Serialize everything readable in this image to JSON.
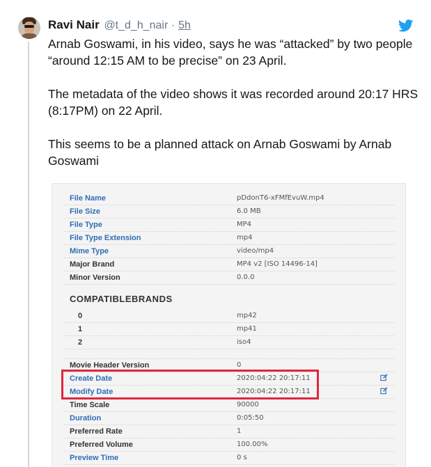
{
  "tweet": {
    "display_name": "Ravi Nair",
    "handle": "@t_d_h_nair",
    "separator": "·",
    "time": "5h",
    "paragraphs": [
      "Arnab Goswami, in his video, says he was “attacked” by two people “around 12:15 AM to be precise” on 23 April.",
      "The metadata of the video shows it was recorded around 20:17 HRS (8:17PM) on 22 April.",
      "This seems to be a planned attack on Arnab Goswami by Arnab Goswami"
    ]
  },
  "icons": {
    "brand": "twitter-bird-icon",
    "edit": "edit-icon",
    "brand_color": "#1da1f2",
    "highlight_color": "#e0263d"
  },
  "metadata": {
    "rows_top": [
      {
        "key": "File Name",
        "value": "pDdonT6-xFMfEvuW.mp4",
        "link": true
      },
      {
        "key": "File Size",
        "value": "6.0 MB",
        "link": true
      },
      {
        "key": "File Type",
        "value": "MP4",
        "link": true
      },
      {
        "key": "File Type Extension",
        "value": "mp4",
        "link": true
      },
      {
        "key": "Mime Type",
        "value": "video/mp4",
        "link": true
      },
      {
        "key": "Major Brand",
        "value": "MP4 v2 [ISO 14496-14]",
        "link": false
      },
      {
        "key": "Minor Version",
        "value": "0.0.0",
        "link": false
      }
    ],
    "section_title": "COMPATIBLEBRANDS",
    "brands": [
      {
        "key": "0",
        "value": "mp42"
      },
      {
        "key": "1",
        "value": "mp41"
      },
      {
        "key": "2",
        "value": "iso4"
      }
    ],
    "rows_bottom": [
      {
        "key": "Movie Header Version",
        "value": "0",
        "link": false,
        "edit": false
      },
      {
        "key": "Create Date",
        "value": "2020:04:22 20:17:11",
        "link": true,
        "edit": true
      },
      {
        "key": "Modify Date",
        "value": "2020:04:22 20:17:11",
        "link": true,
        "edit": true
      },
      {
        "key": "Time Scale",
        "value": "90000",
        "link": false,
        "edit": false
      },
      {
        "key": "Duration",
        "value": "0:05:50",
        "link": true,
        "edit": false
      },
      {
        "key": "Preferred Rate",
        "value": "1",
        "link": false,
        "edit": false
      },
      {
        "key": "Preferred Volume",
        "value": "100.00%",
        "link": false,
        "edit": false
      },
      {
        "key": "Preview Time",
        "value": "0 s",
        "link": true,
        "edit": false
      }
    ]
  }
}
